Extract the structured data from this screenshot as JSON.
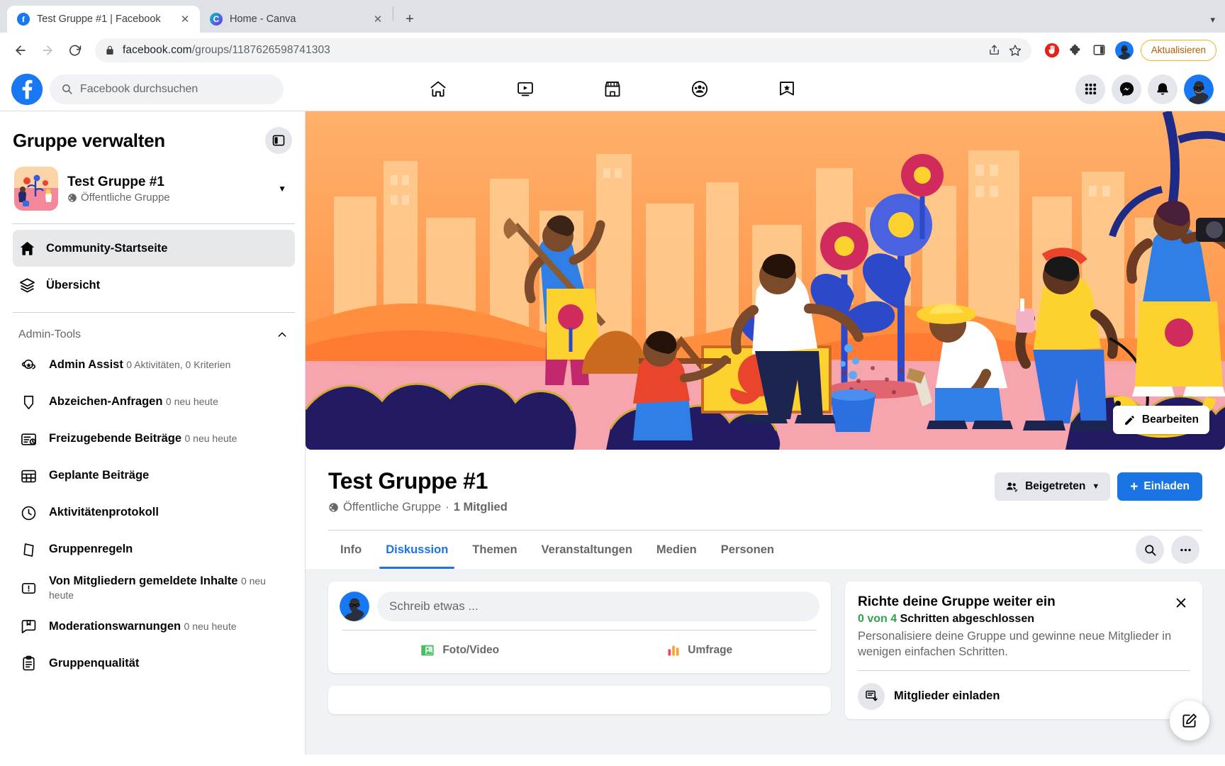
{
  "browser": {
    "tabs": [
      {
        "title": "Test Gruppe #1 | Facebook",
        "favicon": "facebook-favicon",
        "active": true
      },
      {
        "title": "Home - Canva",
        "favicon": "canva-favicon",
        "active": false
      }
    ],
    "new_tab_label": "+",
    "tabstrip_menu_icon": "chevron-down-icon",
    "back_icon": "arrow-left-icon",
    "forward_icon": "arrow-right-icon",
    "reload_icon": "reload-icon",
    "lock_icon": "lock-icon",
    "url_host": "facebook.com",
    "url_path": "/groups/1187626598741303",
    "share_icon": "share-icon",
    "bookmark_icon": "star-icon",
    "extensions": [
      "adblock-icon",
      "puzzle-icon",
      "sidepanel-icon"
    ],
    "profile_icon": "browser-profile-avatar",
    "update_button": "Aktualisieren"
  },
  "fb_header": {
    "logo": "facebook-logo",
    "search_placeholder": "Facebook durchsuchen",
    "search_icon": "search-icon",
    "nav": [
      {
        "name": "home",
        "icon": "home-icon"
      },
      {
        "name": "video",
        "icon": "video-icon"
      },
      {
        "name": "marketplace",
        "icon": "marketplace-icon"
      },
      {
        "name": "groups",
        "icon": "groups-icon"
      },
      {
        "name": "gaming",
        "icon": "gaming-icon"
      }
    ],
    "right": [
      {
        "name": "menu-grid",
        "icon": "grid-icon"
      },
      {
        "name": "messenger",
        "icon": "messenger-icon"
      },
      {
        "name": "notifications",
        "icon": "bell-icon"
      }
    ],
    "account_avatar": "account-avatar"
  },
  "sidebar": {
    "title": "Gruppe verwalten",
    "collapse_icon": "panel-collapse-icon",
    "group": {
      "name": "Test Gruppe #1",
      "privacy": "Öffentliche Gruppe",
      "privacy_icon": "globe-icon",
      "chevron_icon": "chevron-down-icon",
      "thumbnail": "group-thumbnail"
    },
    "nav": [
      {
        "label": "Community-Startseite",
        "icon": "home-filled-icon",
        "active": true
      },
      {
        "label": "Übersicht",
        "icon": "layers-icon",
        "active": false
      }
    ],
    "section": {
      "title": "Admin-Tools",
      "chevron_icon": "chevron-up-icon"
    },
    "tools": [
      {
        "label": "Admin Assist",
        "sub": "0 Aktivitäten, 0 Kriterien",
        "icon": "admin-assist-icon"
      },
      {
        "label": "Abzeichen-Anfragen",
        "sub": "0 neu heute",
        "icon": "badge-icon"
      },
      {
        "label": "Freizugebende Beiträge",
        "sub": "0 neu heute",
        "icon": "pending-posts-icon"
      },
      {
        "label": "Geplante Beiträge",
        "sub": "",
        "icon": "calendar-grid-icon"
      },
      {
        "label": "Aktivitätenprotokoll",
        "sub": "",
        "icon": "clock-icon"
      },
      {
        "label": "Gruppenregeln",
        "sub": "",
        "icon": "rules-icon"
      },
      {
        "label": "Von Mitgliedern gemeldete Inhalte",
        "sub": "0 neu heute",
        "icon": "alert-icon"
      },
      {
        "label": "Moderationswarnungen",
        "sub": "0 neu heute",
        "icon": "moderation-icon"
      },
      {
        "label": "Gruppenqualität",
        "sub": "",
        "icon": "clipboard-icon"
      }
    ]
  },
  "cover": {
    "edit_label": "Bearbeiten",
    "edit_icon": "pencil-icon",
    "cursor_icon": "mouse-cursor"
  },
  "group_header": {
    "title": "Test Gruppe #1",
    "privacy": "Öffentliche Gruppe",
    "privacy_icon": "globe-icon",
    "separator": "·",
    "members": "1 Mitglied",
    "joined_button": "Beigetreten",
    "joined_icon": "members-check-icon",
    "joined_chevron": "chevron-down-icon",
    "invite_button": "Einladen",
    "invite_icon": "plus-icon"
  },
  "tabs": {
    "items": [
      {
        "label": "Info",
        "active": false
      },
      {
        "label": "Diskussion",
        "active": true
      },
      {
        "label": "Themen",
        "active": false
      },
      {
        "label": "Veranstaltungen",
        "active": false
      },
      {
        "label": "Medien",
        "active": false
      },
      {
        "label": "Personen",
        "active": false
      }
    ],
    "search_icon": "search-icon",
    "more_icon": "ellipsis-icon"
  },
  "composer": {
    "avatar": "user-avatar",
    "placeholder": "Schreib etwas ...",
    "actions": [
      {
        "label": "Foto/Video",
        "icon": "photo-video-icon",
        "color": "#45bd62"
      },
      {
        "label": "Umfrage",
        "icon": "poll-icon",
        "color": "#f3425f"
      }
    ]
  },
  "setup_card": {
    "title": "Richte deine Gruppe weiter ein",
    "progress_prefix": "0 von 4",
    "progress_suffix": "Schritten abgeschlossen",
    "progress_color": "#31a24c",
    "description": "Personalisiere deine Gruppe und gewinne neue Mitglieder in wenigen einfachen Schritten.",
    "close_icon": "close-icon",
    "items": [
      {
        "label": "Mitglieder einladen",
        "icon": "invite-members-icon"
      }
    ]
  },
  "fab": {
    "icon": "compose-icon"
  },
  "theme": {
    "fb_blue": "#1877f2",
    "fb_blue_dark": "#1b74e4",
    "grey_bg": "#f0f2f5",
    "grey_btn": "#e4e6eb",
    "text_secondary": "#65676b",
    "green": "#31a24c",
    "update_orange": "#b06000"
  }
}
